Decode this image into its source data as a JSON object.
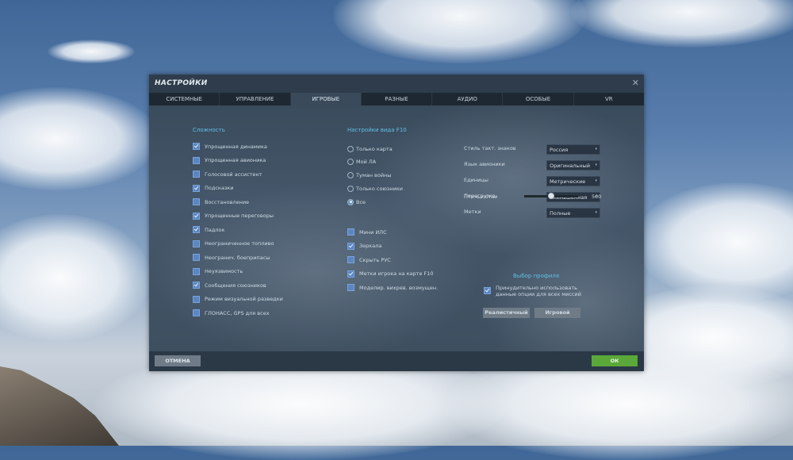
{
  "window": {
    "title": "НАСТРОЙКИ",
    "close_icon": "close-icon"
  },
  "tabs": [
    {
      "label": "СИСТЕМНЫЕ",
      "active": false
    },
    {
      "label": "УПРАВЛЕНИЕ",
      "active": false
    },
    {
      "label": "ИГРОВЫЕ",
      "active": true
    },
    {
      "label": "РАЗНЫЕ",
      "active": false
    },
    {
      "label": "АУДИО",
      "active": false
    },
    {
      "label": "ОСОБЫЕ",
      "active": false
    },
    {
      "label": "VR",
      "active": false
    }
  ],
  "difficulty": {
    "title": "Сложность",
    "items": [
      {
        "label": "Упрощенная динамика",
        "checked": true
      },
      {
        "label": "Упрощенная авионика",
        "checked": false
      },
      {
        "label": "Голосовой ассистент",
        "checked": false
      },
      {
        "label": "Подсказки",
        "checked": true
      },
      {
        "label": "Восстановление",
        "checked": false
      },
      {
        "label": "Упрощенные переговоры",
        "checked": true
      },
      {
        "label": "Падлок",
        "checked": true
      },
      {
        "label": "Неограниченное топливо",
        "checked": false
      },
      {
        "label": "Неогранич. боеприпасы",
        "checked": false
      },
      {
        "label": "Неуязвимость",
        "checked": false
      },
      {
        "label": "Сообщения союзников",
        "checked": true
      },
      {
        "label": "Режим визуальной разведки",
        "checked": false
      },
      {
        "label": "ГЛОНАСС, GPS для всех",
        "checked": false
      }
    ]
  },
  "f10": {
    "title": "Настройки вида F10",
    "radios": [
      {
        "label": "Только карта",
        "selected": false
      },
      {
        "label": "Мой ЛА",
        "selected": false
      },
      {
        "label": "Туман войны",
        "selected": false
      },
      {
        "label": "Только союзники",
        "selected": false
      },
      {
        "label": "Все",
        "selected": true
      }
    ],
    "checks": [
      {
        "label": "Мини ИЛС",
        "checked": false
      },
      {
        "label": "Зеркала",
        "checked": true
      },
      {
        "label": "Скрыть РУС",
        "checked": false
      },
      {
        "label": "Метки игрока на карте F10",
        "checked": true
      },
      {
        "label": "Моделир. вихрев. возмущен.",
        "checked": false
      }
    ]
  },
  "options": [
    {
      "label": "Стиль такт. знаков",
      "value": "Россия"
    },
    {
      "label": "Язык авионики",
      "value": "Оригинальный"
    },
    {
      "label": "Единицы",
      "value": "Метрические"
    },
    {
      "label": "Перегрузка",
      "value": "Уменьшенная"
    },
    {
      "label": "Метки",
      "value": "Полные"
    }
  ],
  "birds": {
    "label": "Птичьи стаи",
    "value": "500",
    "fraction": 0.5
  },
  "profile": {
    "title": "Выбор профиля",
    "force_label": "Принудительно использовать\nданные опции для всех миссий",
    "force_checked": true,
    "realistic": "Реалистичный",
    "game": "Игровой"
  },
  "footer": {
    "cancel": "ОТМЕНА",
    "ok": "ОК"
  },
  "colors": {
    "accent": "#5fc0e8",
    "ok_button": "#5aa83a",
    "highlight": "#e04848"
  }
}
